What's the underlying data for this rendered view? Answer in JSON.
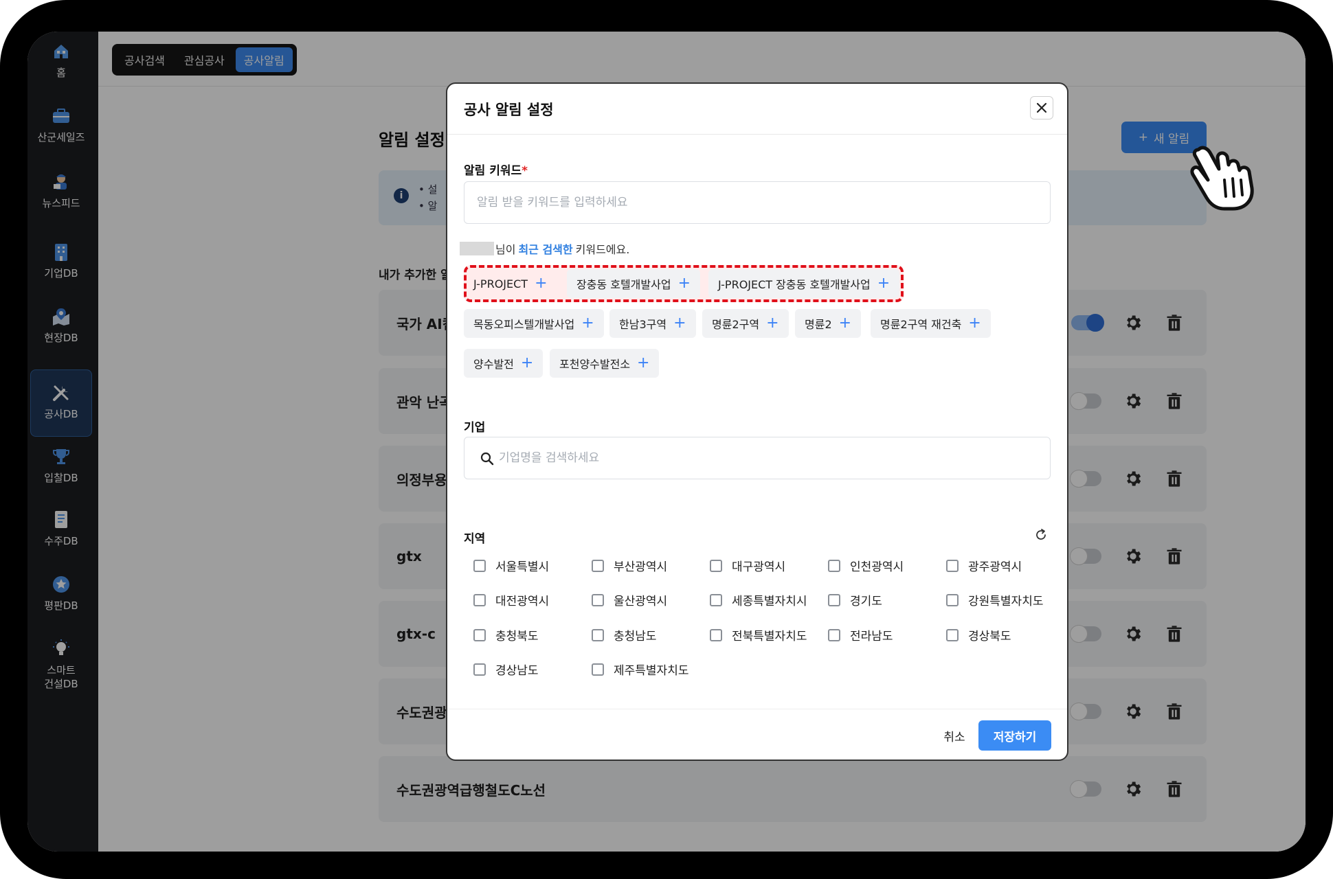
{
  "sidebar": {
    "items": [
      {
        "label": "홈",
        "icon": "home-icon"
      },
      {
        "label": "산군세일즈",
        "icon": "briefcase-icon"
      },
      {
        "label": "뉴스피드",
        "icon": "news-reporter-icon"
      },
      {
        "label": "기업DB",
        "icon": "building-icon"
      },
      {
        "label": "현장DB",
        "icon": "map-pin-icon"
      },
      {
        "label": "공사DB",
        "icon": "tools-icon"
      },
      {
        "label": "입찰DB",
        "icon": "trophy-icon"
      },
      {
        "label": "수주DB",
        "icon": "document-icon"
      },
      {
        "label": "평판DB",
        "icon": "star-badge-icon"
      },
      {
        "label": "스마트\n건설DB",
        "icon": "lightbulb-icon"
      }
    ],
    "active": "공사DB"
  },
  "topnav": {
    "tabs": [
      "공사검색",
      "관심공사",
      "공사알림"
    ],
    "active": "공사알림"
  },
  "page": {
    "title": "알림 설정",
    "new_alert_label": "새 알림",
    "info_lines": [
      "• 설",
      "• 알"
    ],
    "my_list_title": "내가 추가한 알",
    "alerts": [
      {
        "name": "국가 AI컴",
        "enabled": true
      },
      {
        "name": "관악 난곡",
        "enabled": false
      },
      {
        "name": "의정부용",
        "enabled": false
      },
      {
        "name": "gtx",
        "enabled": false
      },
      {
        "name": "gtx-c",
        "enabled": false
      },
      {
        "name": "수도권광",
        "enabled": false
      },
      {
        "name": "수도권광역급행철도C노선",
        "enabled": false
      }
    ]
  },
  "modal": {
    "title": "공사 알림 설정",
    "keyword_label": "알림 키워드",
    "keyword_required_mark": "*",
    "keyword_placeholder": "알림 받을 키워드를 입력하세요",
    "recent": {
      "prefix": "님이",
      "emphasis": "최근 검색한",
      "suffix": "키워드에요."
    },
    "keywords": [
      "J-PROJECT",
      "장충동 호텔개발사업",
      "J-PROJECT 장충동 호텔개발사업",
      "목동오피스텔개발사업",
      "한남3구역",
      "명륜2구역",
      "명륜2",
      "명륜2구역 재건축",
      "양수발전",
      "포천양수발전소"
    ],
    "company_label": "기업",
    "company_placeholder": "기업명을 검색하세요",
    "region_label": "지역",
    "regions": [
      "서울특별시",
      "부산광역시",
      "대구광역시",
      "인천광역시",
      "광주광역시",
      "대전광역시",
      "울산광역시",
      "세종특별자치시",
      "경기도",
      "강원특별자치도",
      "충청북도",
      "충청남도",
      "전북특별자치도",
      "전라남도",
      "경상북도",
      "경상남도",
      "제주특별자치도"
    ],
    "cancel_label": "취소",
    "save_label": "저장하기"
  },
  "colors": {
    "accent": "#3b8cf4",
    "highlight": "#e0101a",
    "sidebar_bg": "#1c1d21"
  }
}
